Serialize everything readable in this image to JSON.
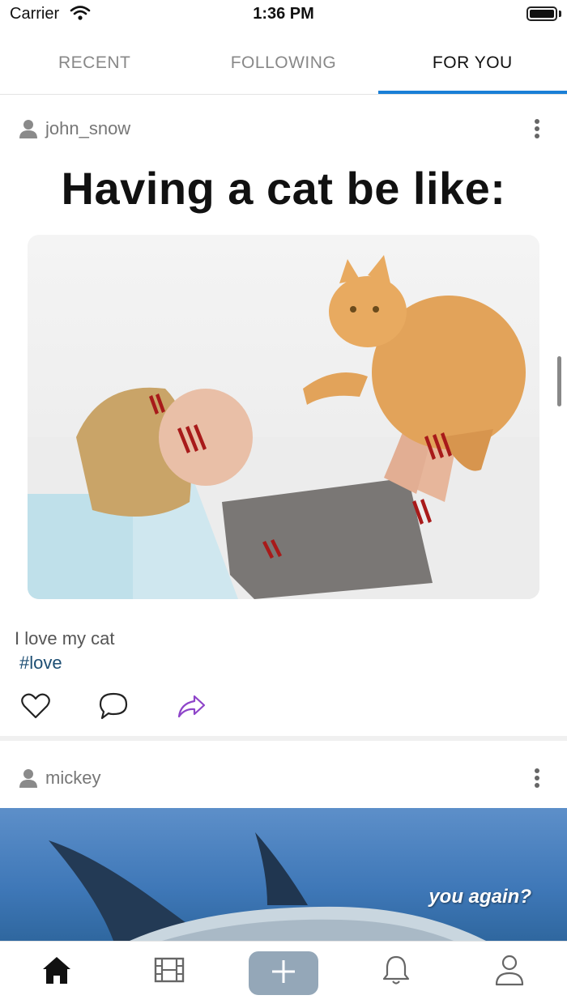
{
  "status_bar": {
    "carrier": "Carrier",
    "time": "1:36 PM"
  },
  "tabs": [
    {
      "label": "RECENT",
      "active": false
    },
    {
      "label": "FOLLOWING",
      "active": false
    },
    {
      "label": "FOR YOU",
      "active": true
    }
  ],
  "posts": [
    {
      "username": "john_snow",
      "meme_title": "Having a cat be like:",
      "caption": "I love my cat",
      "hashtag": "#love"
    },
    {
      "username": "mickey",
      "image_text": "you again?"
    }
  ],
  "colors": {
    "active_tab_indicator": "#1a7fd6",
    "hashtag": "#1d4e73",
    "share_icon": "#8e44c9",
    "add_button": "#94a7b8"
  },
  "bottom_nav": [
    {
      "icon": "home-icon",
      "active": true
    },
    {
      "icon": "film-icon",
      "active": false
    },
    {
      "icon": "plus-icon",
      "active": false
    },
    {
      "icon": "bell-icon",
      "active": false
    },
    {
      "icon": "profile-icon",
      "active": false
    }
  ]
}
